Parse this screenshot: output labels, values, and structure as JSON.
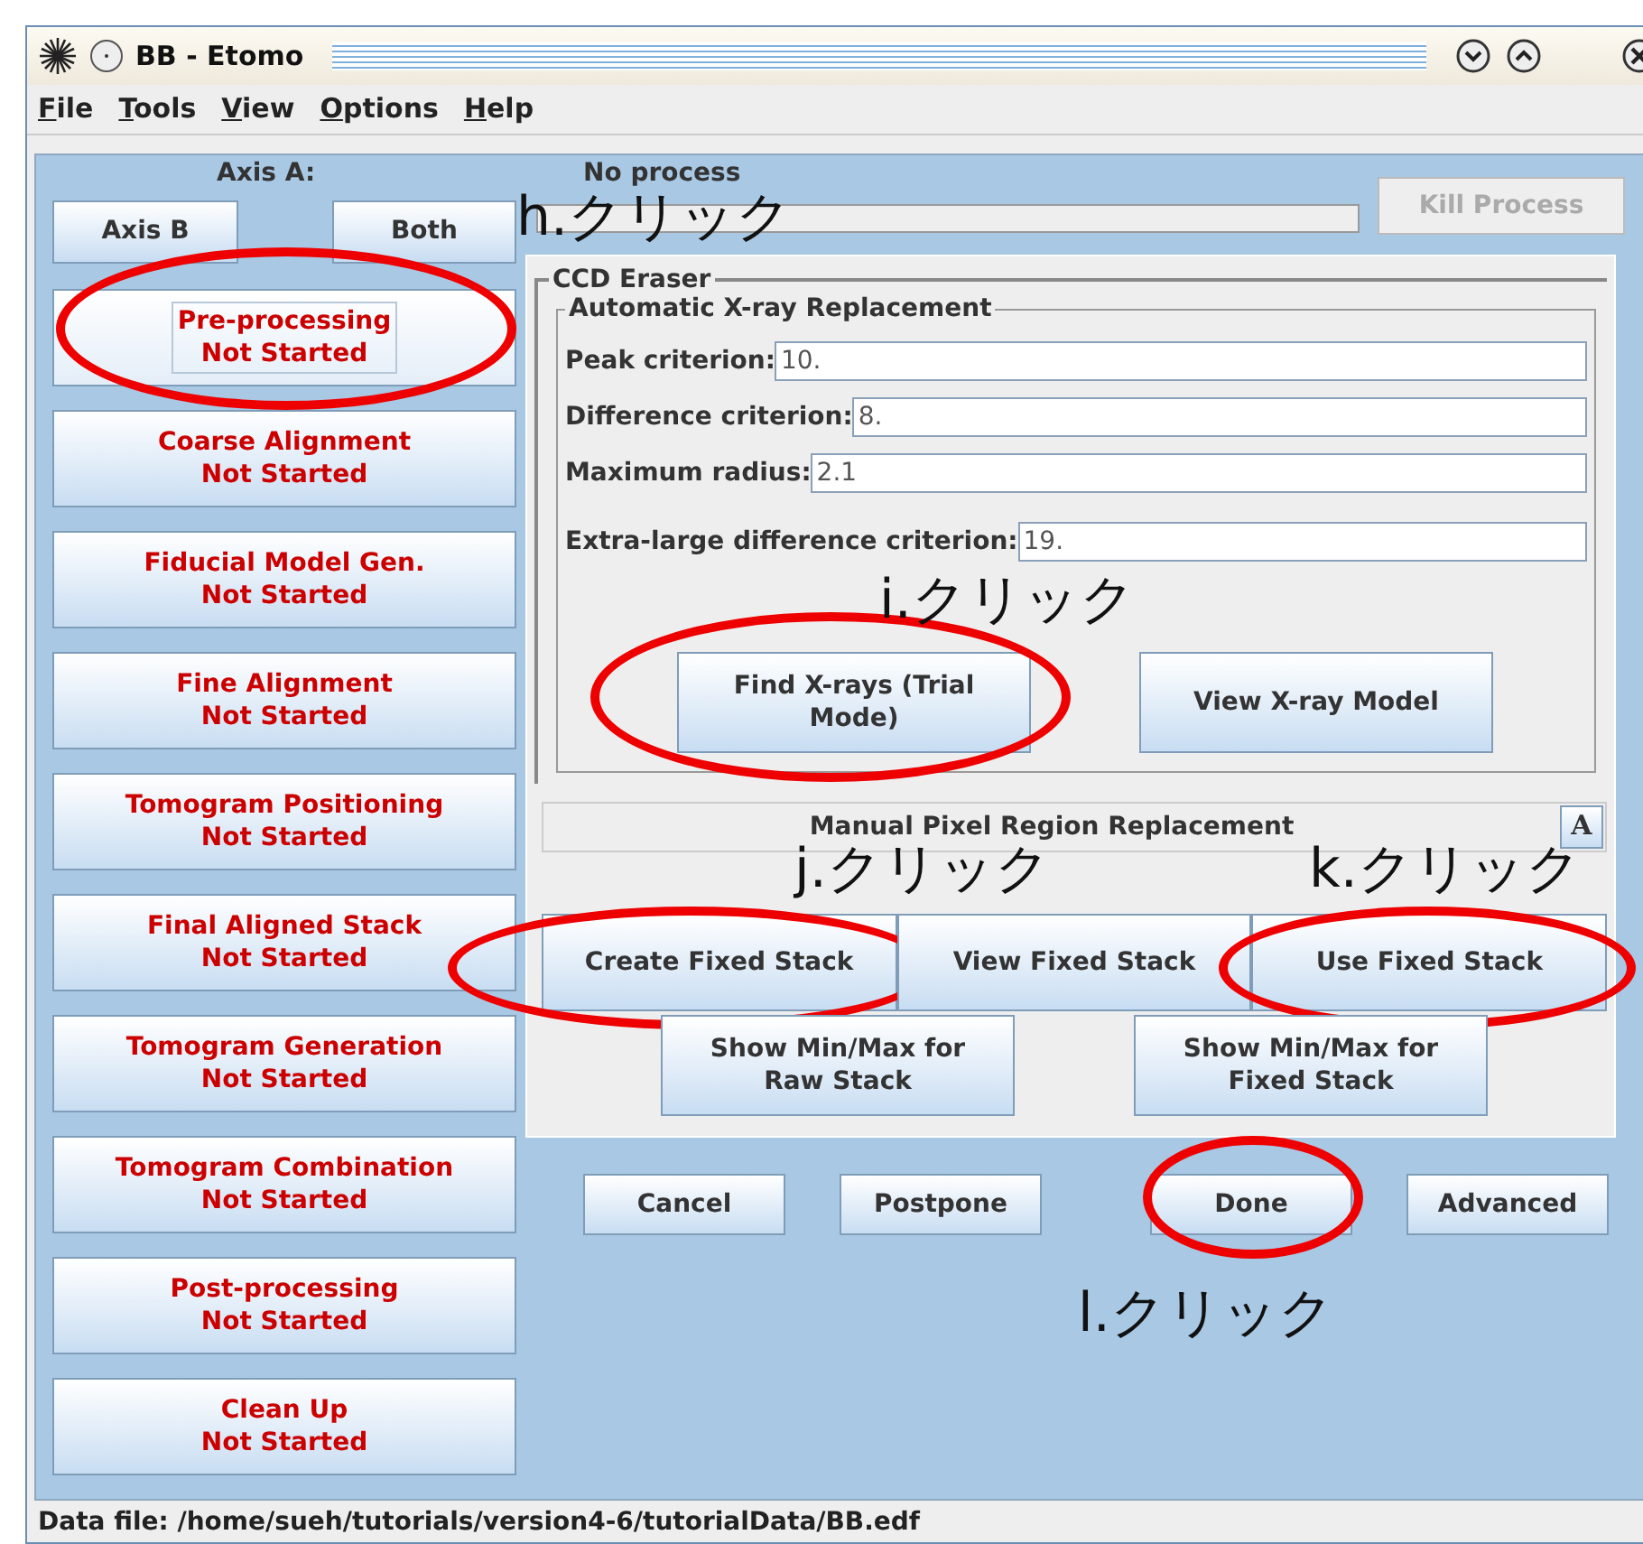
{
  "window": {
    "title": "BB - Etomo"
  },
  "menu": [
    "File",
    "Tools",
    "View",
    "Options",
    "Help"
  ],
  "axis": {
    "label": "Axis A:",
    "buttons": [
      {
        "label": "Axis B"
      },
      {
        "label": "Both"
      }
    ]
  },
  "process": {
    "status": "No process",
    "kill_button": {
      "label": "Kill Process",
      "disabled": true
    }
  },
  "sidebar": {
    "items": [
      {
        "title": "Pre-processing",
        "status": "Not Started",
        "selected": true,
        "circled": true
      },
      {
        "title": "Coarse Alignment",
        "status": "Not Started",
        "selected": false,
        "circled": false
      },
      {
        "title": "Fiducial Model Gen.",
        "status": "Not Started",
        "selected": false,
        "circled": false
      },
      {
        "title": "Fine Alignment",
        "status": "Not Started",
        "selected": false,
        "circled": false
      },
      {
        "title": "Tomogram Positioning",
        "status": "Not Started",
        "selected": false,
        "circled": false
      },
      {
        "title": "Final Aligned Stack",
        "status": "Not Started",
        "selected": false,
        "circled": false
      },
      {
        "title": "Tomogram Generation",
        "status": "Not Started",
        "selected": false,
        "circled": false
      },
      {
        "title": "Tomogram Combination",
        "status": "Not Started",
        "selected": false,
        "circled": false
      },
      {
        "title": "Post-processing",
        "status": "Not Started",
        "selected": false,
        "circled": false
      },
      {
        "title": "Clean Up",
        "status": "Not Started",
        "selected": false,
        "circled": false
      }
    ]
  },
  "panel": {
    "title": "CCD Eraser",
    "auto": {
      "title": "Automatic X-ray Replacement",
      "fields": [
        {
          "label": "Peak criterion:",
          "value": "10."
        },
        {
          "label": "Difference criterion:",
          "value": "8."
        },
        {
          "label": "Maximum radius:",
          "value": "2.1"
        },
        {
          "label": "Extra-large difference criterion:",
          "value": "19."
        }
      ],
      "buttons": [
        {
          "label": "Find X-rays (Trial Mode)",
          "circled": true
        },
        {
          "label": "View X-ray Model",
          "circled": false
        }
      ]
    },
    "manual": {
      "title": "Manual Pixel Region Replacement",
      "toggle": "A",
      "buttons": [
        {
          "label": "Create Fixed Stack",
          "circled": true
        },
        {
          "label": "View Fixed Stack",
          "circled": false
        },
        {
          "label": "Use Fixed Stack",
          "circled": true
        }
      ],
      "buttons_2": [
        {
          "label": "Show Min/Max for Raw Stack",
          "circled": false
        },
        {
          "label": "Show Min/Max for Fixed Stack",
          "circled": false
        }
      ]
    }
  },
  "actions": [
    {
      "label": "Cancel",
      "circled": false
    },
    {
      "label": "Postpone",
      "circled": false
    },
    {
      "label": "Done",
      "circled": true
    },
    {
      "label": "Advanced",
      "circled": false
    }
  ],
  "annotations": [
    "h.クリック",
    "i.クリック",
    "j.クリック",
    "k.クリック",
    "l.クリック"
  ],
  "status_bar": "Data file: /home/sueh/tutorials/version4-6/tutorialData/BB.edf"
}
